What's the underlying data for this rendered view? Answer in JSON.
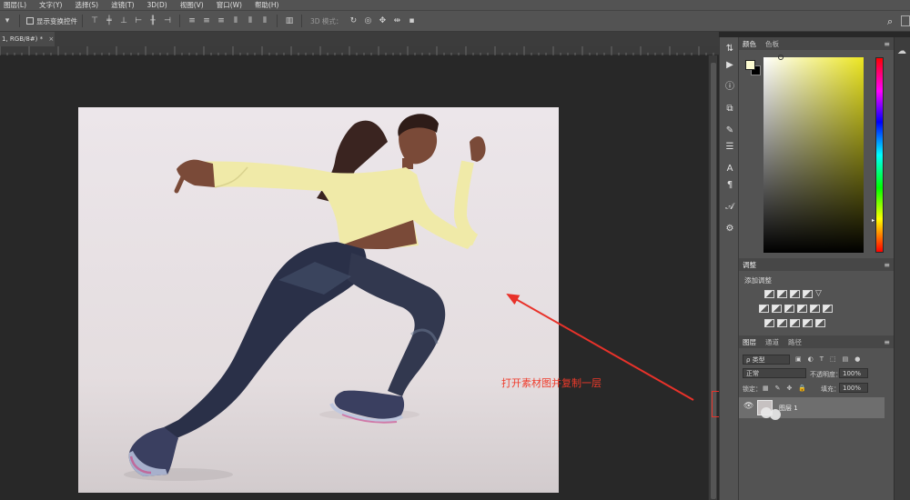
{
  "menu": [
    "图层(L)",
    "文字(Y)",
    "选择(S)",
    "滤镜(T)",
    "3D(D)",
    "视图(V)",
    "窗口(W)",
    "帮助(H)"
  ],
  "options": {
    "transform_controls_label": "显示变换控件",
    "mode_3d": "3D 模式："
  },
  "document": {
    "tab_title": "1, RGB/8#) *"
  },
  "annotation": {
    "text": "打开素材图并复制一层",
    "color": "#ef3a2a"
  },
  "panels": {
    "color": {
      "tabs": [
        "颜色",
        "色板"
      ],
      "foreground": "#fcfbd1",
      "background": "#000000"
    },
    "adjustments": {
      "tab": "调整",
      "subtitle": "添加调整"
    },
    "layers": {
      "tabs": [
        "图层",
        "通道",
        "路径"
      ],
      "filter_kind": "ρ 类型",
      "blend_mode": "正常",
      "opacity_label": "不透明度：",
      "opacity": "100%",
      "lock_label": "锁定：",
      "fill_label": "填充：",
      "fill": "100%",
      "layer_name": "图层 1"
    }
  }
}
